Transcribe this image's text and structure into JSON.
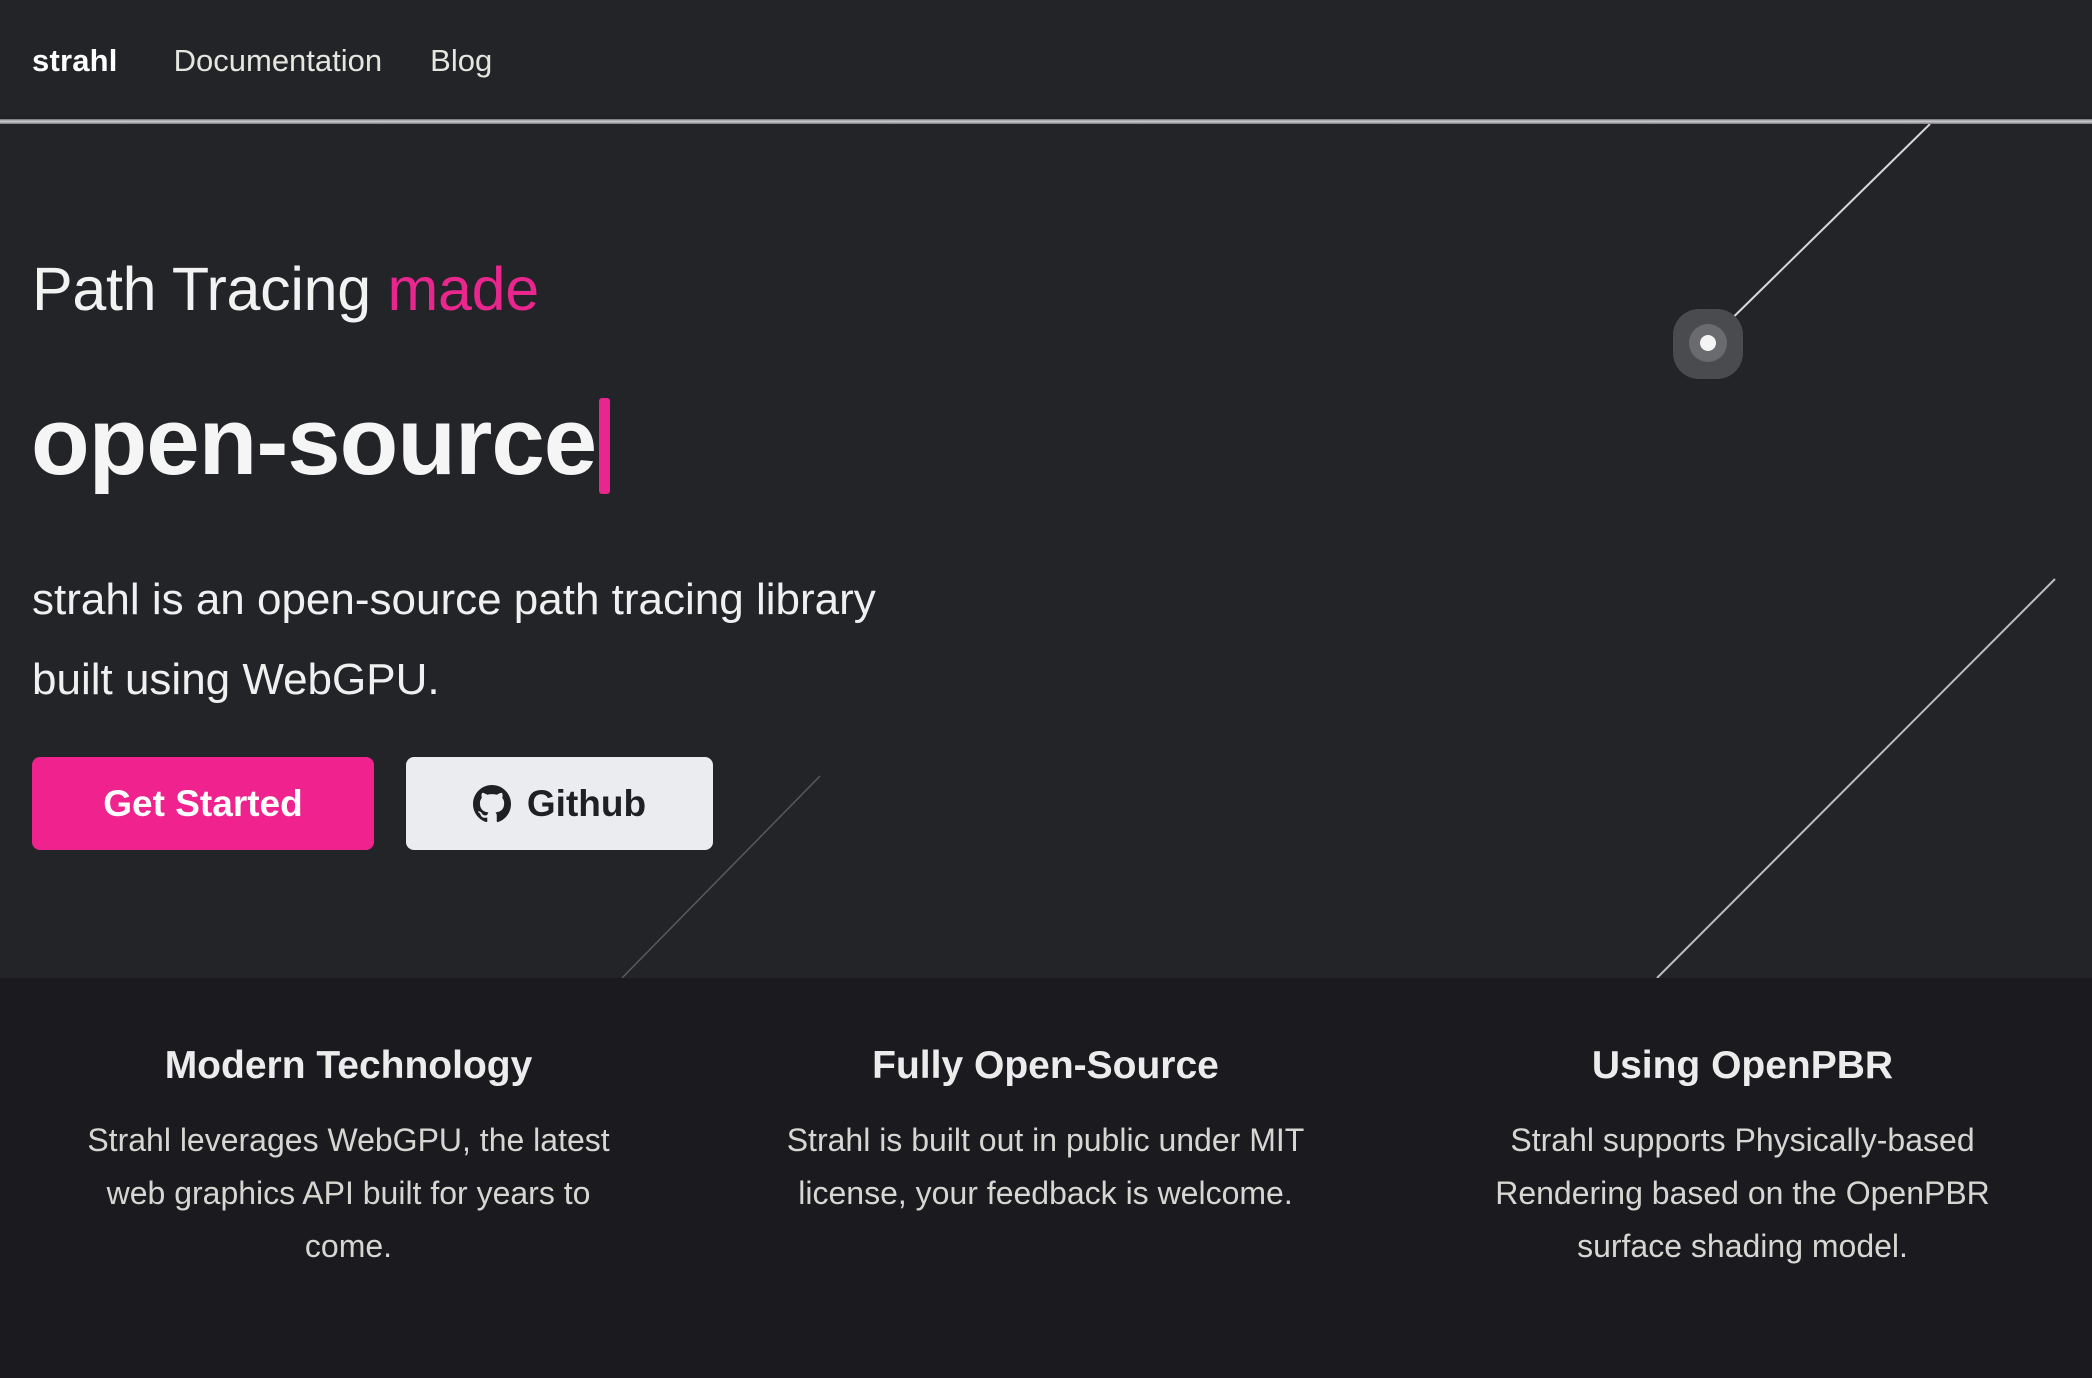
{
  "nav": {
    "brand": "strahl",
    "links": [
      "Documentation",
      "Blog"
    ]
  },
  "hero": {
    "headline_prefix": "Path Tracing ",
    "headline_accent": "made",
    "typed_word": "open-source",
    "description": "strahl is an open-source path tracing library built using WebGPU.",
    "primary_button": "Get Started",
    "secondary_button": "Github",
    "secondary_button_icon": "github-icon"
  },
  "features": [
    {
      "title": "Modern Technology",
      "text": "Strahl leverages WebGPU, the latest web graphics API built for years to come."
    },
    {
      "title": "Fully Open-Source",
      "text": "Strahl is built out in public under MIT license, your feedback is welcome."
    },
    {
      "title": "Using OpenPBR",
      "text": "Strahl supports Physically-based Rendering based on the OpenPBR surface shading model."
    }
  ],
  "colors": {
    "accent": "#e9268e",
    "button_primary": "#f0238e",
    "hero_bg": "#232428",
    "features_bg": "#1b1b1f"
  }
}
